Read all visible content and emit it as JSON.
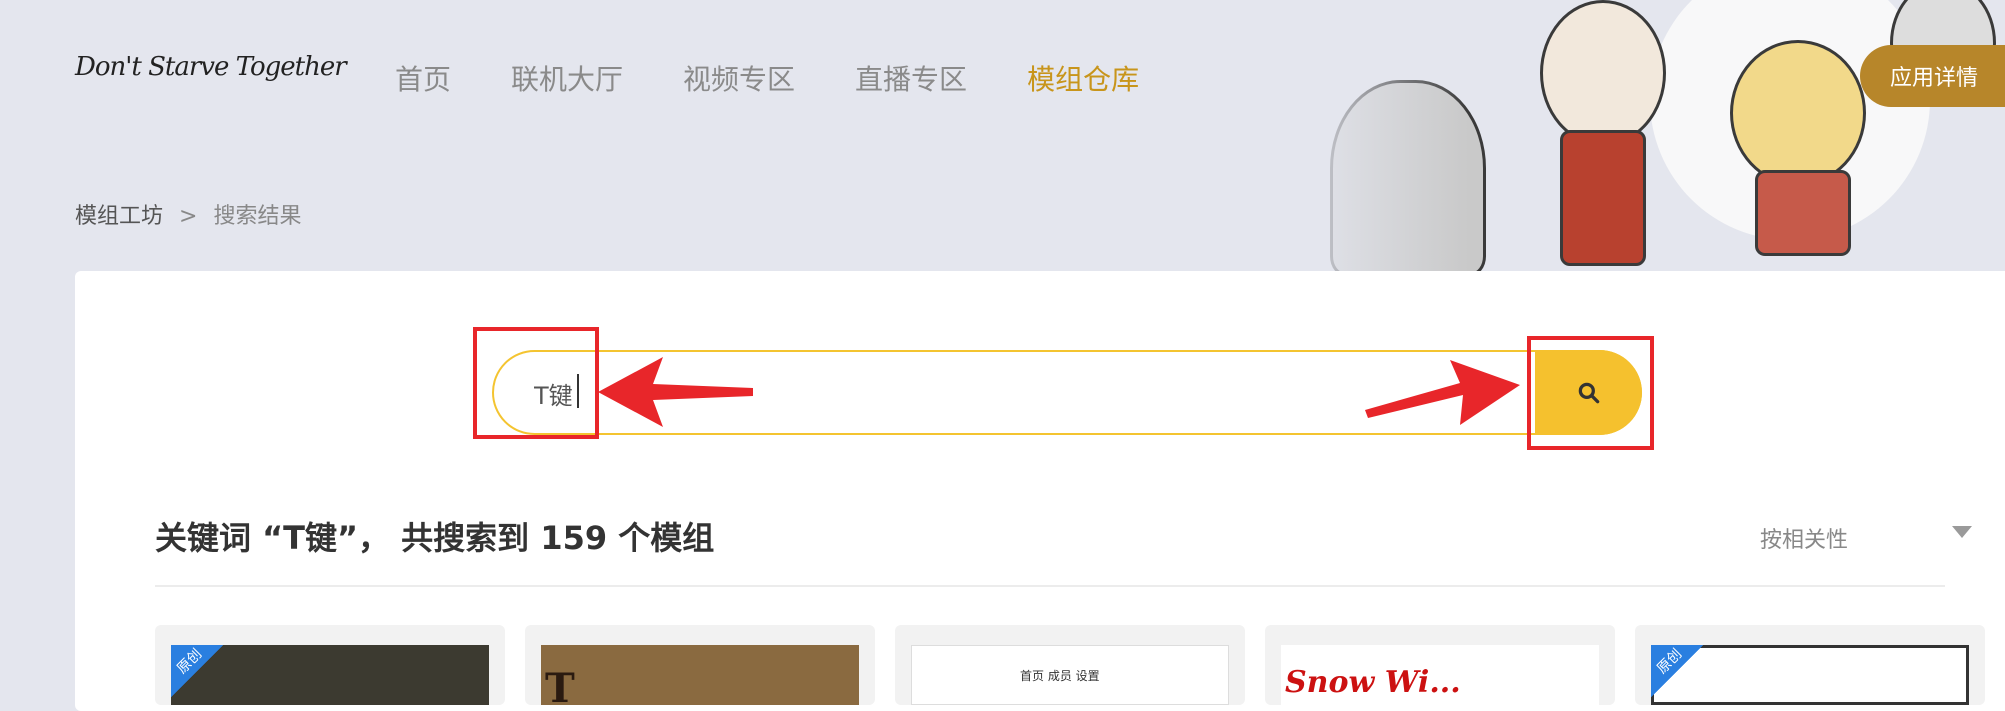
{
  "header": {
    "logo": "Don't Starve Together",
    "nav": [
      "首页",
      "联机大厅",
      "视频专区",
      "直播专区",
      "模组仓库"
    ],
    "active_nav_index": 4,
    "app_button": "应用详情"
  },
  "breadcrumb": {
    "root": "模组工坊",
    "separator": ">",
    "current": "搜索结果"
  },
  "search": {
    "value": "T键"
  },
  "results": {
    "title": "关键词 “T键”， 共搜索到 159 个模组",
    "sort_label": "按相关性"
  },
  "thumbs": {
    "badge": "原创",
    "mini_nav": "首页 成员 设置",
    "red_text": "Snow Wi..."
  },
  "colors": {
    "accent": "#f5c12e",
    "active_nav": "#c8951b",
    "highlight": "#e8262a",
    "app_button": "#b7862a"
  },
  "icons": {
    "search": "search-icon",
    "sort": "caret-down-icon"
  }
}
